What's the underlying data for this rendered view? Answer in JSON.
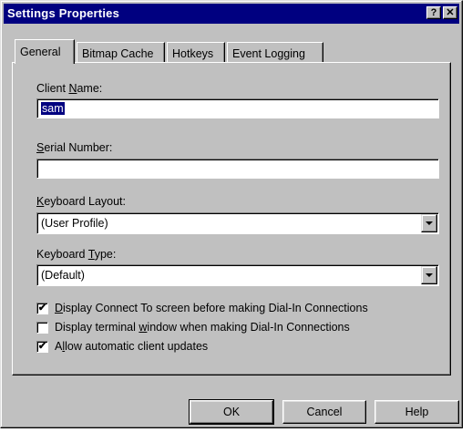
{
  "window": {
    "title": "Settings Properties",
    "help_btn": "?",
    "close_btn": "✕"
  },
  "tabs": [
    {
      "label": "General",
      "active": true
    },
    {
      "label": "Bitmap Cache",
      "active": false
    },
    {
      "label": "Hotkeys",
      "active": false
    },
    {
      "label": "Event Logging",
      "active": false
    }
  ],
  "fields": {
    "client_name": {
      "label_pre": "Client ",
      "label_key": "N",
      "label_post": "ame:",
      "value": "sam"
    },
    "serial_number": {
      "label_pre": "",
      "label_key": "S",
      "label_post": "erial Number:",
      "value": ""
    },
    "keyboard_layout": {
      "label_pre": "",
      "label_key": "K",
      "label_post": "eyboard Layout:",
      "value": "(User Profile)"
    },
    "keyboard_type": {
      "label_pre": "Keyboard ",
      "label_key": "T",
      "label_post": "ype:",
      "value": "(Default)"
    }
  },
  "checkboxes": [
    {
      "pre": "",
      "key": "D",
      "post": "isplay Connect To screen before making Dial-In Connections",
      "checked": "✔"
    },
    {
      "pre": "Display terminal ",
      "key": "w",
      "post": "indow when making Dial-In Connections",
      "checked": ""
    },
    {
      "pre": "A",
      "key": "l",
      "post": "low automatic client updates",
      "checked": "✔"
    }
  ],
  "buttons": {
    "ok": "OK",
    "cancel": "Cancel",
    "help": "Help"
  }
}
